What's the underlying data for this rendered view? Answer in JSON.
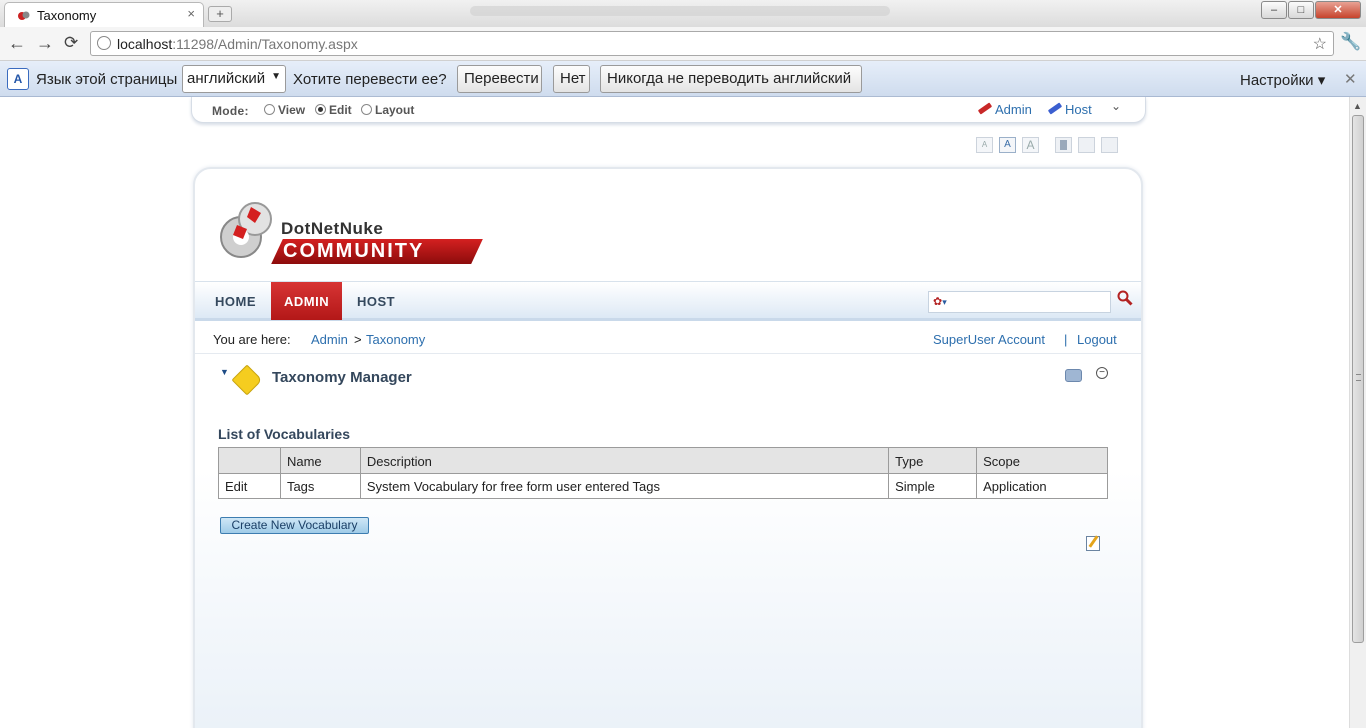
{
  "browser": {
    "tab_title": "Taxonomy",
    "tab_close": "×",
    "new_tab": "+",
    "window_buttons": {
      "minimize": "–",
      "maximize": "□",
      "close": "✕"
    },
    "url_host": "localhost",
    "url_path": ":11298/Admin/Taxonomy.aspx",
    "icons": {
      "back": "←",
      "forward": "→",
      "reload": "⟳",
      "star": "☆",
      "wrench": "🔧"
    }
  },
  "translate_bar": {
    "icon_letter": "A",
    "label": "Язык этой страницы",
    "language": "английский",
    "question": "Хотите перевести ее?",
    "translate_button": "Перевести",
    "no_button": "Нет",
    "never_button": "Никогда не переводить английский",
    "settings": "Настройки ▾",
    "close": "✕"
  },
  "control_panel": {
    "mode_label": "Mode:",
    "modes": [
      "View",
      "Edit",
      "Layout"
    ],
    "selected_mode": "Edit",
    "admin_link": "Admin",
    "host_link": "Host",
    "collapse": "⌄",
    "font_sizes": [
      "A",
      "A",
      "A"
    ]
  },
  "site": {
    "logo_top": "DotNetNuke",
    "logo_bottom": "COMMUNITY",
    "nav": [
      "HOME",
      "ADMIN",
      "HOST"
    ],
    "active_nav": "ADMIN",
    "search_placeholder": "",
    "search_engine_caret": "▾",
    "search_icon": "🔍",
    "breadcrumb_label": "You are here:",
    "breadcrumb": [
      "Admin",
      "Taxonomy"
    ],
    "breadcrumb_sep": ">",
    "user_link": "SuperUser Account",
    "user_sep": "|",
    "logout_link": "Logout"
  },
  "module": {
    "toggle": "▼",
    "title": "Taxonomy Manager",
    "minimize": "−",
    "list_heading": "List of Vocabularies",
    "columns": [
      "",
      "Name",
      "Description",
      "Type",
      "Scope"
    ],
    "rows": [
      {
        "action": "Edit",
        "name": "Tags",
        "description": "System Vocabulary for free form user entered Tags",
        "type": "Simple",
        "scope": "Application"
      }
    ],
    "create_button": "Create New Vocabulary"
  }
}
